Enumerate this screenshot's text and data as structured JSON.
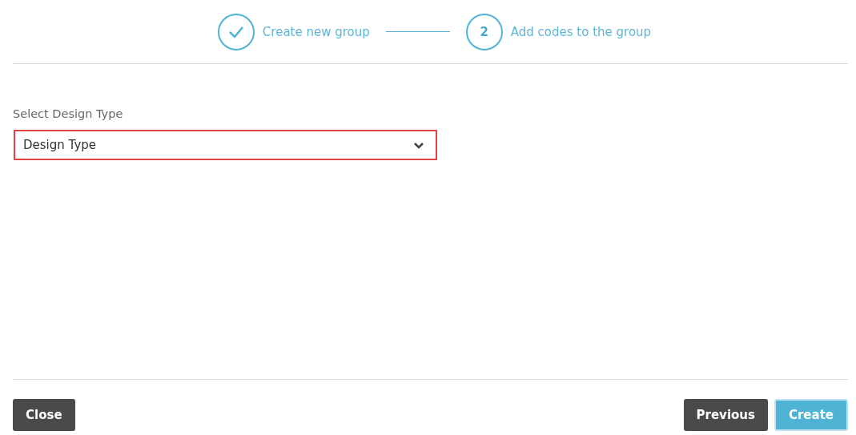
{
  "steps": [
    {
      "label": "Create new group",
      "completed": true
    },
    {
      "number": "2",
      "label": "Add codes to the group",
      "completed": false
    }
  ],
  "field": {
    "label": "Select Design Type",
    "value": "Design Type",
    "invalid": true
  },
  "footer": {
    "left_buttons": [
      {
        "label": "Close",
        "kind": "secondary"
      }
    ],
    "right_buttons": [
      {
        "label": "Previous",
        "kind": "secondary"
      },
      {
        "label": "Create",
        "kind": "primary"
      }
    ]
  }
}
